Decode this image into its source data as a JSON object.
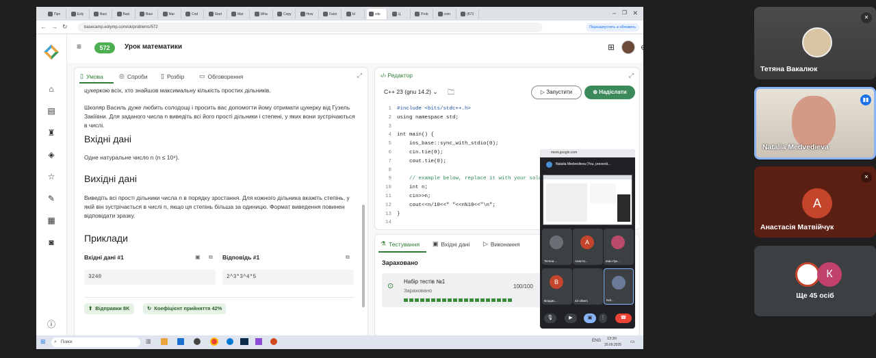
{
  "browser": {
    "tabs": [
      "Про",
      "Eoly",
      "Basi",
      "Basi",
      "Basi",
      "Mar",
      "Cod",
      "Start",
      "Mar",
      "Wha",
      "Copy",
      "How",
      "Faire",
      "Ы",
      "site",
      "Ц",
      "Prob",
      "com",
      "(873"
    ],
    "url": "basecamp.eolymp.com/uk/problems/572",
    "update_label": "Перезапустить и обновить"
  },
  "app": {
    "badge": "572",
    "title": "Урок математики",
    "left_tabs": [
      "Умова",
      "Спроби",
      "Розбір",
      "Обговорення"
    ],
    "statement": {
      "p0": "цукеркою всіх, хто знайшов максимальну кількість простих дільників.",
      "p1": "Школяр Василь дуже любить солодощі і просить вас допомогти йому отримати цукерку від Гузель Закіївни. Для заданого числа n виведіть всі його прості дільники і степені, у яких вони зустрічаються в числі.",
      "input_heading": "Вхідні дані",
      "input_text": "Одне натуральне число n (n ≤ 10⁹).",
      "output_heading": "Вихідні дані",
      "output_text": "Виведіть всі прості дільники числа n в порядку зростання. Для кожного дільника вкажіть степінь, у якій він зустрічається в числі n, якщо ця степінь більша за одиницю. Формат виведення повинен відповідати зразку.",
      "examples_heading": "Приклади",
      "input_label": "Вхідні дані #1",
      "output_label": "Відповідь #1",
      "input_value": "3240",
      "output_value": "2^3*3^4*5",
      "chip_submissions": "Відправки 8K",
      "chip_acceptance": "Коефіцієнт прийняття 42%"
    },
    "editor": {
      "title": "Редактор",
      "language": "C++ 23 (gnu 14.2)",
      "run_label": "Запустити",
      "submit_label": "Надіслати",
      "lines": [
        "#include <bits/stdc++.h>",
        "using namespace std;",
        "",
        "int main() {",
        "    ios_base::sync_with_stdio(0);",
        "    cin.tie(0);",
        "    cout.tie(0);",
        "",
        "    // example below, replace it with your solution:",
        "    int n;",
        "    cin>>n;",
        "    cout<<n/10<<\" \"<<n%10<<\"\\n\";",
        "}",
        ""
      ]
    },
    "testing": {
      "tabs": [
        "Тестування",
        "Вхідні дані",
        "Виконання"
      ],
      "status": "Зараховано",
      "set_name": "Набір тестів №1",
      "set_status": "Зараховано",
      "score": "100/100",
      "passed_tests": 20
    }
  },
  "meet_popup": {
    "url": "meet.google.com",
    "presenter": "Natalia Medvedieva (You, presenti...",
    "tiles": [
      {
        "name": "Тетяна ...",
        "initial": "",
        "color": "#6a6f75"
      },
      {
        "name": "Анаста...",
        "initial": "А",
        "color": "#c4452b"
      },
      {
        "name": "Іван Лук...",
        "initial": "",
        "color": "#b94a6a"
      },
      {
        "name": "Владис...",
        "initial": "В",
        "color": "#c4452b"
      },
      {
        "name": "43 others",
        "initial": "",
        "color": "#3c4043"
      },
      {
        "name": "Nat...",
        "initial": "",
        "color": "#6a7a99"
      }
    ]
  },
  "taskbar": {
    "search_placeholder": "Поиск",
    "language": "ENG",
    "time": "13:30",
    "date": "20.09.2025"
  },
  "participants": [
    {
      "name": "Тетяна Вакалюк"
    },
    {
      "name": "Natalia Medvedieva"
    },
    {
      "name": "Анастасія Матвійчук",
      "initial": "А"
    },
    {
      "name": "Ще 45 осіб",
      "initial": "К"
    }
  ],
  "colors": {
    "accent_green": "#2e7d32",
    "submit_green": "#3c8a5c",
    "avatar_red": "#c4452b",
    "avatar_pink": "#c2416a"
  }
}
